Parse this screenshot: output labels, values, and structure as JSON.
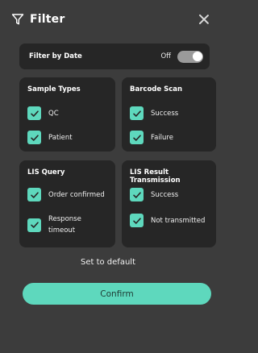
{
  "header": {
    "title": "Filter",
    "filter_icon": "funnel-icon",
    "close_icon": "close-icon"
  },
  "filter_by_date": {
    "label": "Filter by Date",
    "state": "Off",
    "enabled": false
  },
  "sample_types": {
    "title": "Sample Types",
    "options": [
      {
        "label": "QC",
        "checked": true
      },
      {
        "label": "Patient",
        "checked": true
      }
    ]
  },
  "barcode_scan": {
    "title": "Barcode Scan",
    "options": [
      {
        "label": "Success",
        "checked": true
      },
      {
        "label": "Failure",
        "checked": true
      }
    ]
  },
  "lis_query": {
    "title": "LIS Query",
    "options": [
      {
        "label": "Order confirmed",
        "checked": true
      },
      {
        "label": "Response timeout",
        "checked": true
      }
    ]
  },
  "lis_result_transmission": {
    "title": "LIS Result Transmission",
    "options": [
      {
        "label": "Success",
        "checked": true
      },
      {
        "label": "Not transmitted",
        "checked": true
      }
    ]
  },
  "actions": {
    "reset_label": "Set to default",
    "confirm_label": "Confirm"
  },
  "colors": {
    "background": "#3c3c3c",
    "card": "#262626",
    "accent": "#5ed8bd",
    "toggle_off": "#9a9a9a"
  }
}
